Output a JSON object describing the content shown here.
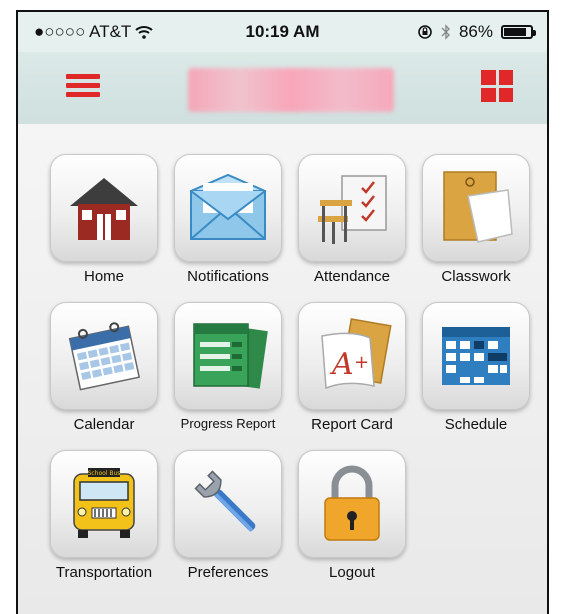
{
  "status_bar": {
    "carrier": "●○○○○ AT&T",
    "time": "10:19 AM",
    "battery_percent": "86%",
    "battery_level": 0.86
  },
  "nav": {
    "menu_icon": "hamburger-icon",
    "grid_icon": "grid-icon",
    "accent_color": "#e02828"
  },
  "tiles": [
    {
      "label": "Home",
      "icon": "house-icon"
    },
    {
      "label": "Notifications",
      "icon": "envelope-icon"
    },
    {
      "label": "Attendance",
      "icon": "school-desk-checklist-icon"
    },
    {
      "label": "Classwork",
      "icon": "folder-papers-icon"
    },
    {
      "label": "Calendar",
      "icon": "calendar-icon"
    },
    {
      "label": "Progress Report",
      "icon": "progress-report-icon"
    },
    {
      "label": "Report Card",
      "icon": "report-card-icon"
    },
    {
      "label": "Schedule",
      "icon": "schedule-icon"
    },
    {
      "label": "Transportation",
      "icon": "school-bus-icon"
    },
    {
      "label": "Preferences",
      "icon": "wrench-icon"
    },
    {
      "label": "Logout",
      "icon": "padlock-icon"
    }
  ],
  "bus_sign": "School Bus"
}
